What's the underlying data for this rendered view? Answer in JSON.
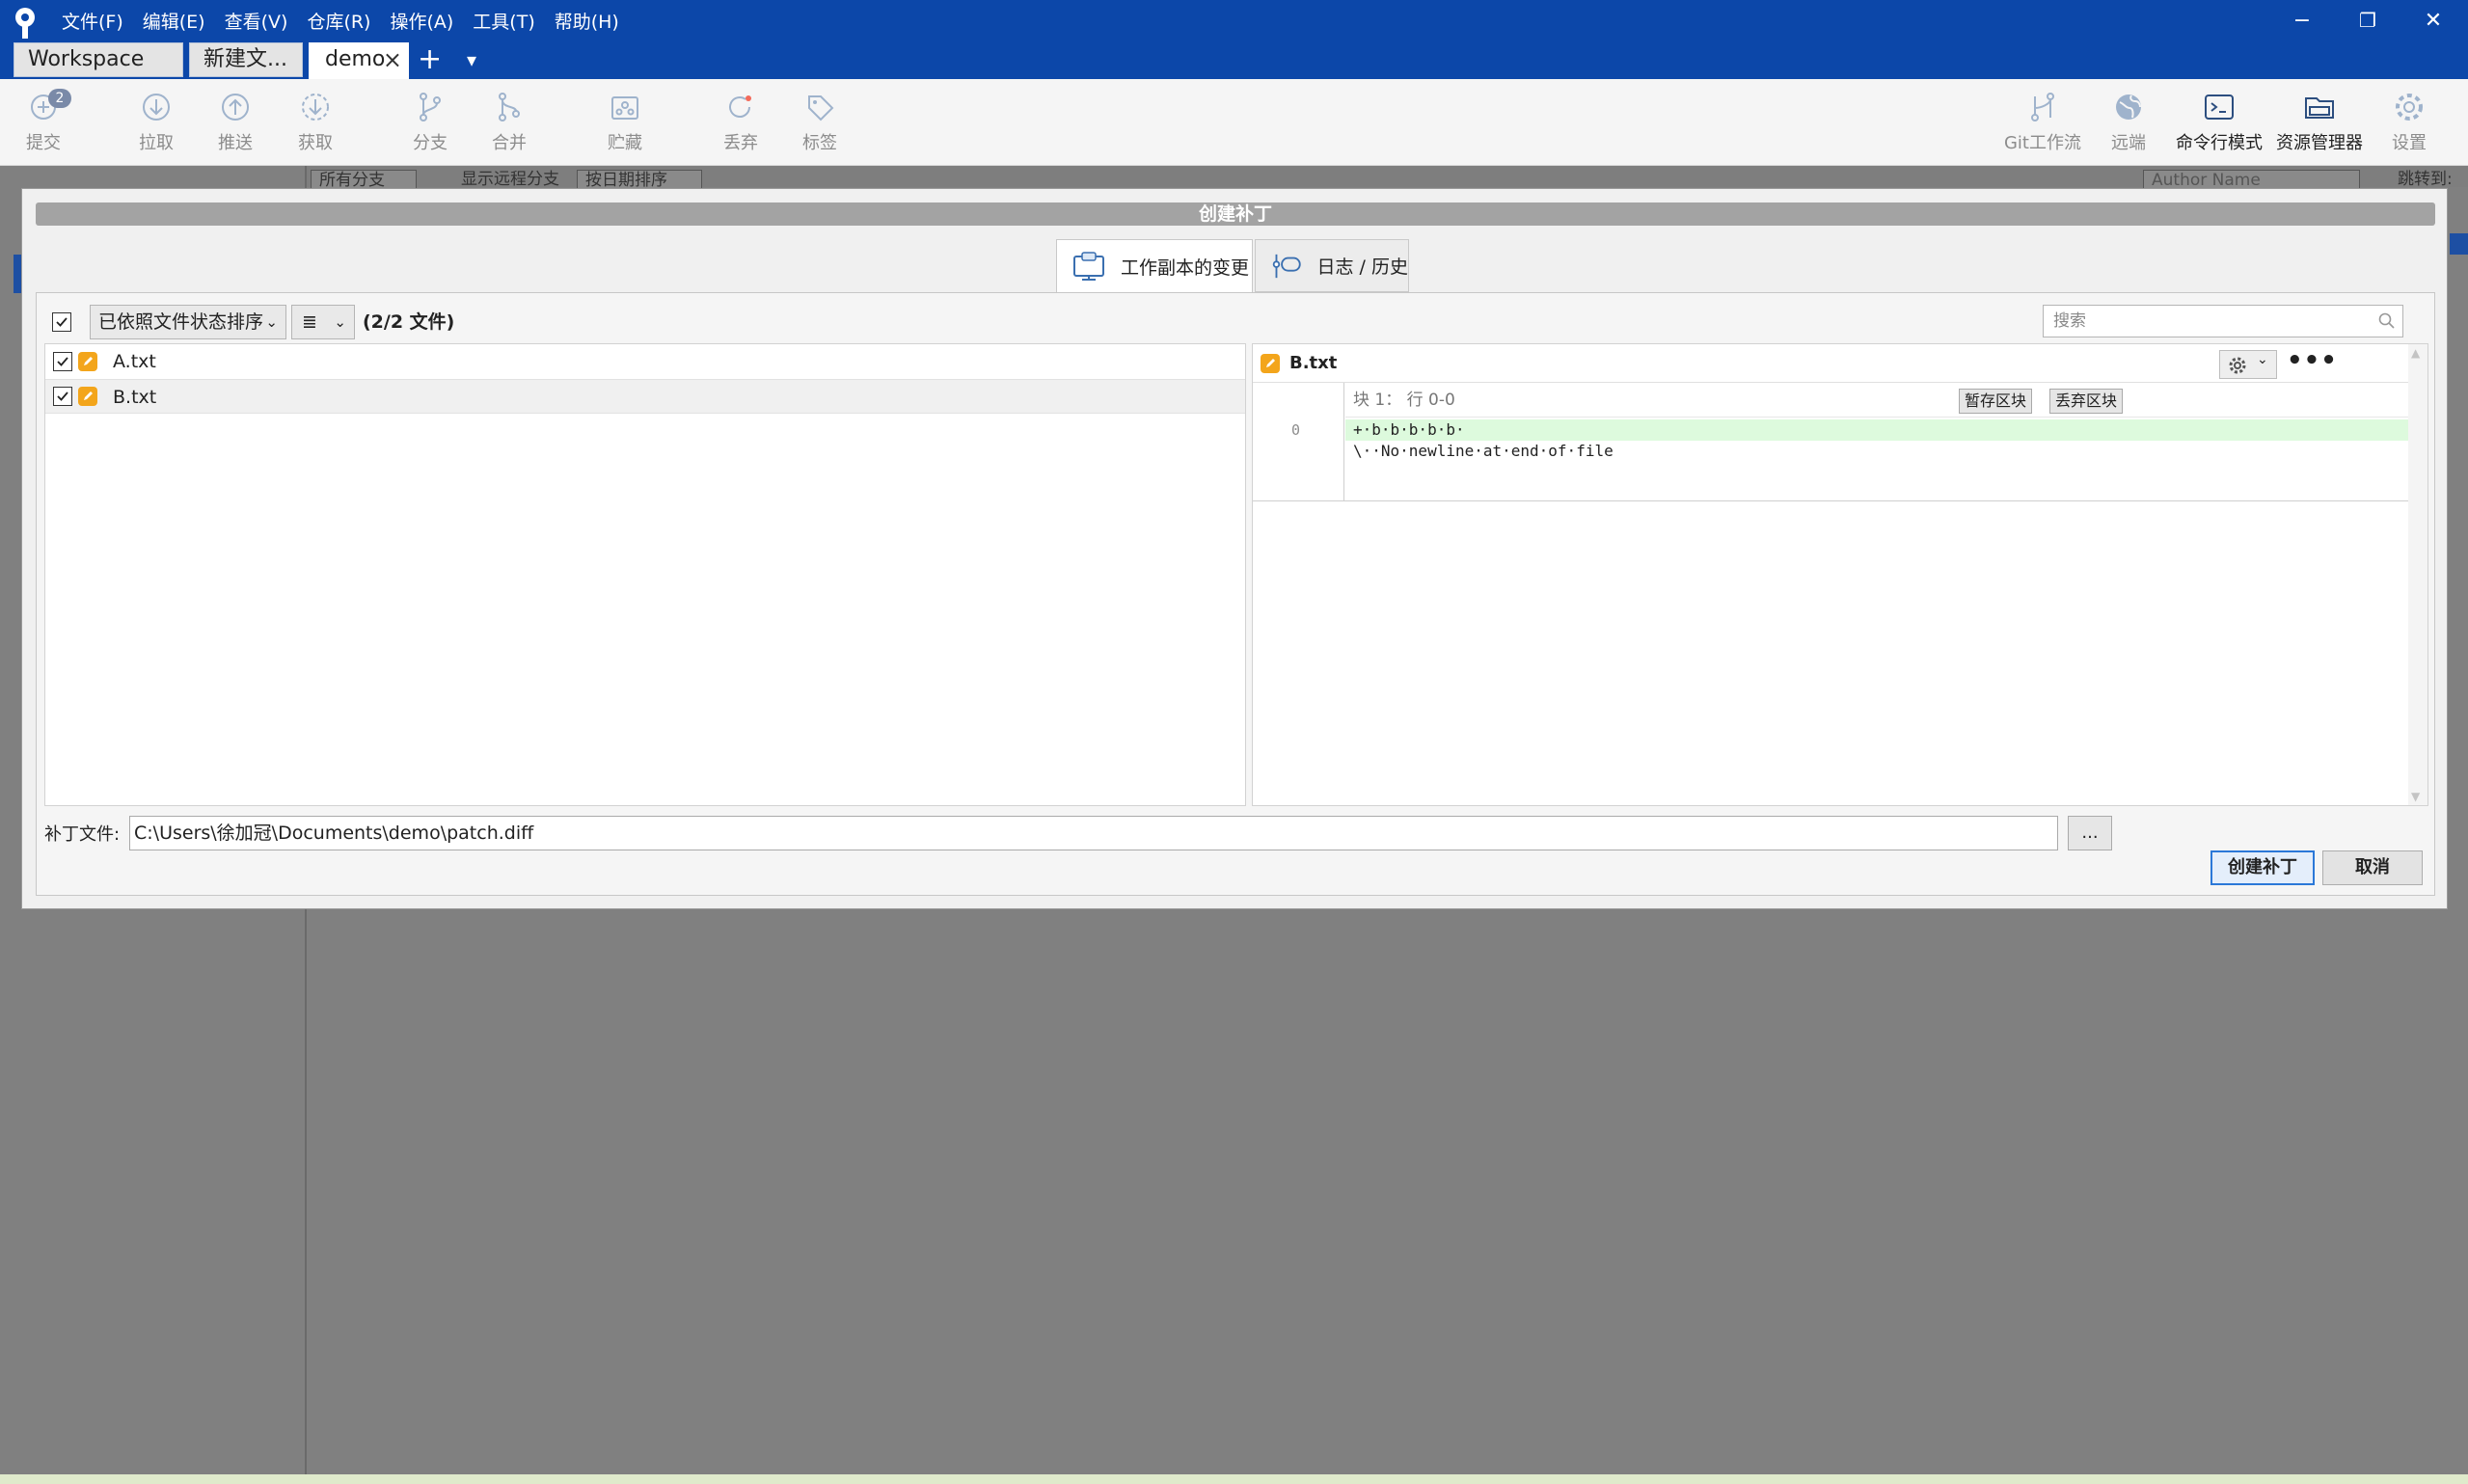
{
  "window": {
    "menu": [
      "文件(F)",
      "编辑(E)",
      "查看(V)",
      "仓库(R)",
      "操作(A)",
      "工具(T)",
      "帮助(H)"
    ],
    "controls": {
      "minimize": "−",
      "restore": "❐",
      "close": "✕"
    }
  },
  "tabs": [
    {
      "label": "Workspace"
    },
    {
      "label": "新建文..."
    },
    {
      "label": "demo",
      "active": true
    }
  ],
  "tab_actions": {
    "add": "+",
    "menu": "▾"
  },
  "toolbar": {
    "commit": {
      "label": "提交",
      "badge": "2",
      "icon": "plus-circle-icon"
    },
    "pull": {
      "label": "拉取",
      "icon": "arrow-down-circle-icon"
    },
    "push": {
      "label": "推送",
      "icon": "arrow-up-circle-icon"
    },
    "fetch": {
      "label": "获取",
      "icon": "dashed-arrow-down-circle-icon"
    },
    "branch": {
      "label": "分支",
      "icon": "branch-icon"
    },
    "merge": {
      "label": "合并",
      "icon": "merge-icon"
    },
    "stash": {
      "label": "贮藏",
      "icon": "stash-icon"
    },
    "discard": {
      "label": "丢弃",
      "icon": "discard-icon"
    },
    "tag": {
      "label": "标签",
      "icon": "tag-icon"
    },
    "gitflow": {
      "label": "Git工作流",
      "icon": "gitflow-icon"
    },
    "remote": {
      "label": "远端",
      "icon": "globe-icon"
    },
    "terminal": {
      "label": "命令行模式",
      "icon": "terminal-icon"
    },
    "explorer": {
      "label": "资源管理器",
      "icon": "folder-icon"
    },
    "settings": {
      "label": "设置",
      "icon": "gear-icon"
    }
  },
  "background": {
    "all_branches": "所有分支",
    "show_remote": "显示远程分支",
    "sort_by_date": "按日期排序",
    "author_placeholder": "Author Name",
    "jump_to": "跳转到:"
  },
  "dialog": {
    "title": "创建补丁",
    "mode_tabs": [
      {
        "label": "工作副本的变更",
        "active": true,
        "icon": "working-copy-icon"
      },
      {
        "label": "日志 / 历史",
        "active": false,
        "icon": "log-history-icon"
      }
    ],
    "sort_label": "已依照文件状态排序",
    "view_icon": "≣",
    "file_count": "(2/2 文件)",
    "search_placeholder": "搜索",
    "files": [
      {
        "name": "A.txt",
        "checked": true,
        "status": "modified"
      },
      {
        "name": "B.txt",
        "checked": true,
        "status": "modified",
        "selected": true
      }
    ],
    "diff": {
      "filename": "B.txt",
      "hunk_title": "块 1： 行 0-0",
      "stage_hunk": "暂存区块",
      "discard_hunk": "丢弃区块",
      "line_number": "0",
      "lines": [
        {
          "text": "+·b·b·b·b·b·",
          "type": "added"
        },
        {
          "text": "\\··No·newline·at·end·of·file",
          "type": "context"
        }
      ]
    },
    "patch_label": "补丁文件:",
    "patch_path": "C:\\Users\\徐加冠\\Documents\\demo\\patch.diff",
    "browse": "...",
    "ok": "创建补丁",
    "cancel": "取消"
  },
  "colors": {
    "titlebar": "#0c47a9",
    "modified_badge": "#f3a51b",
    "added_line": "#ddfadd",
    "primary_border": "#2b78d8"
  }
}
